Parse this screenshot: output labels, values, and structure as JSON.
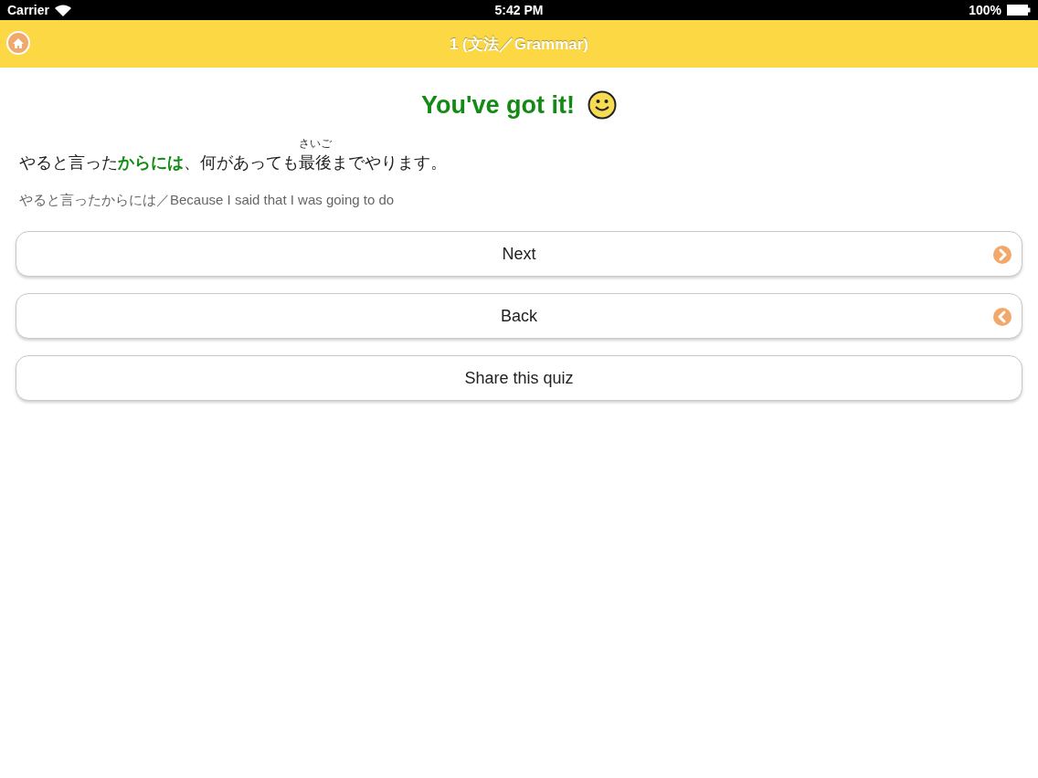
{
  "status_bar": {
    "carrier": "Carrier",
    "time": "5:42 PM",
    "battery": "100%"
  },
  "nav_bar": {
    "title": "1 (文法／Grammar)"
  },
  "result": {
    "message": "You've got it!",
    "correct": true
  },
  "sentence": [
    {
      "kind": "plain",
      "text": "やると言った"
    },
    {
      "kind": "highlight",
      "text": "からには"
    },
    {
      "kind": "plain",
      "text": "、何があっても"
    },
    {
      "kind": "ruby",
      "text": "最後",
      "reading": "さいご"
    },
    {
      "kind": "plain",
      "text": "までやります。"
    }
  ],
  "translation": "やると言ったからには／Because I said that I was going to do",
  "buttons": [
    {
      "label": "Next",
      "kind": "next"
    },
    {
      "label": "Back",
      "kind": "back"
    },
    {
      "label": "Share this quiz",
      "kind": "plain"
    }
  ]
}
